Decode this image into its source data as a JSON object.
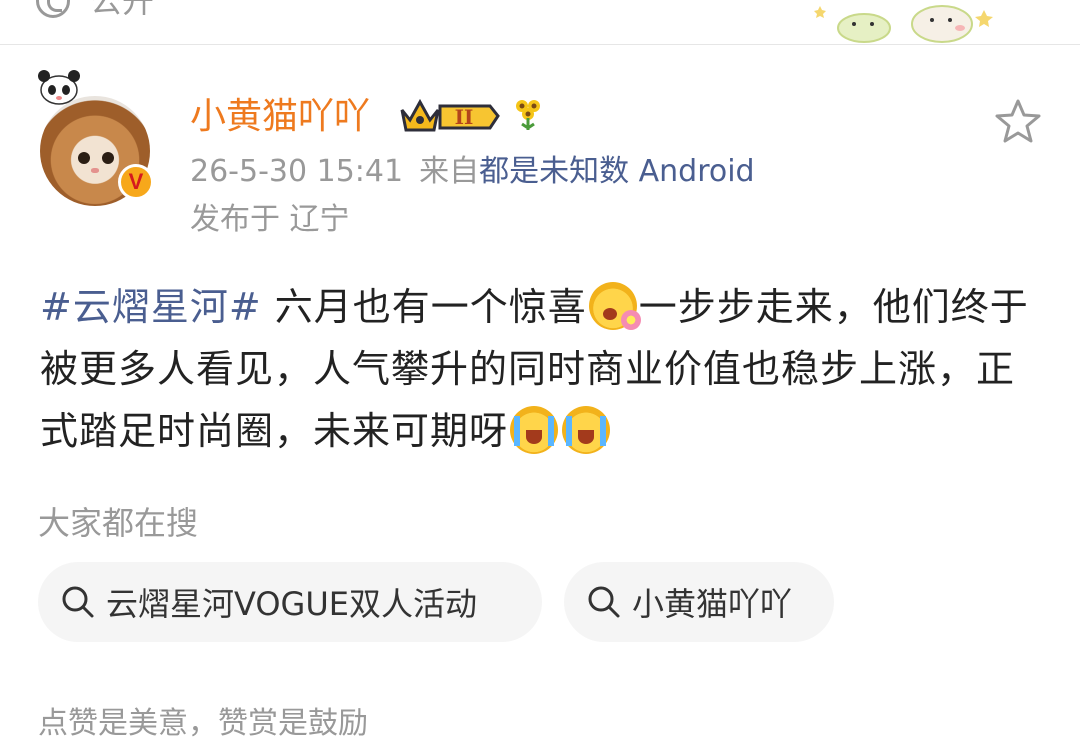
{
  "topbar": {
    "public_label": "公开"
  },
  "post": {
    "author": {
      "username": "小黄猫吖吖",
      "verified_badge": "V",
      "level_badge": "II"
    },
    "meta": {
      "time": "26-5-30 15:41",
      "source_prefix": "来自",
      "source_name": "都是未知数 Android",
      "location": "发布于 辽宁"
    },
    "content": {
      "hashtag": "#云熠星河#",
      "text_1": " 六月也有一个惊喜",
      "text_2": "一步步走来，他们终于被更多人看见，人气攀升的同时商业价值也稳步上涨，正式踏足时尚圈，未来可期呀",
      "emoji_1": "surprise-emoji",
      "emoji_2": "cry-emoji",
      "emoji_3": "cry-emoji"
    }
  },
  "search": {
    "heading": "大家都在搜",
    "chips": [
      {
        "label": "云熠星河VOGUE双人活动"
      },
      {
        "label": "小黄猫吖吖"
      }
    ]
  },
  "footer": {
    "cut_text": "点赞是美意，赞赏是鼓励"
  },
  "colors": {
    "username": "#ee7a1f",
    "link": "#4a5e90",
    "muted": "#999999",
    "chip_bg": "#f5f5f5"
  }
}
